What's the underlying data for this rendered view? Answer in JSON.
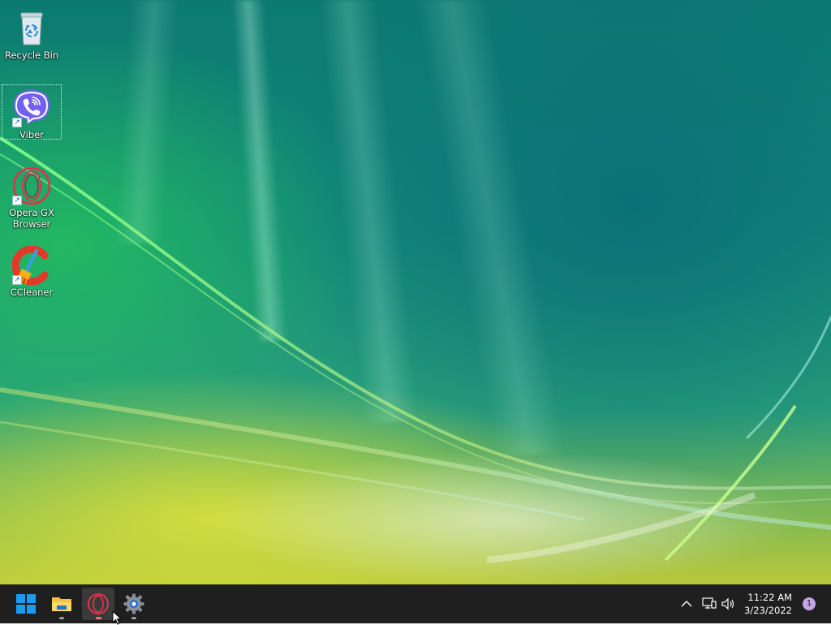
{
  "desktop": {
    "icons": [
      {
        "label": "Recycle Bin",
        "icon": "recycle-bin-icon",
        "shortcut": false
      },
      {
        "label": "Viber",
        "icon": "viber-icon",
        "shortcut": true,
        "selected": true
      },
      {
        "label": "Opera GX Browser",
        "icon": "opera-gx-icon",
        "shortcut": true
      },
      {
        "label": "CCleaner",
        "icon": "ccleaner-icon",
        "shortcut": true
      }
    ]
  },
  "taskbar": {
    "apps": [
      {
        "name": "Start",
        "icon": "windows-start-icon"
      },
      {
        "name": "File Explorer",
        "icon": "file-explorer-icon",
        "running": true
      },
      {
        "name": "Opera GX",
        "icon": "opera-gx-icon",
        "running": true,
        "active": true
      },
      {
        "name": "Settings",
        "icon": "settings-gear-icon",
        "running": true
      }
    ],
    "tray": {
      "icons": [
        "chevron-up-icon",
        "network-icon",
        "volume-icon"
      ],
      "time": "11:22 AM",
      "date": "3/23/2022",
      "notification_count": "1"
    }
  },
  "colors": {
    "taskbar": "#1f1f1f",
    "viber": "#7360f2",
    "opera_gx": "#e0324a",
    "notification_badge": "#c7a3e8",
    "start_blue": "#1e9bf0"
  }
}
